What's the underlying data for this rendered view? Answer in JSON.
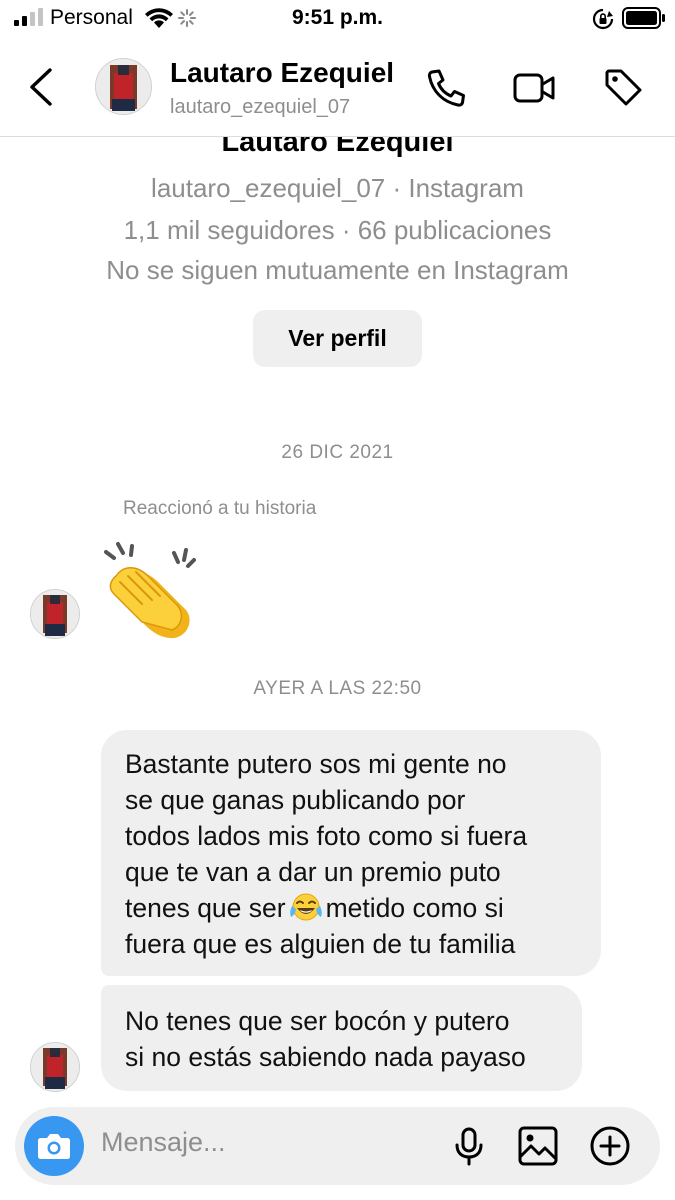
{
  "status_bar": {
    "carrier": "Personal",
    "time": "9:51 p.m."
  },
  "header": {
    "name": "Lautaro Ezequiel",
    "username": "lautaro_ezequiel_07"
  },
  "profile": {
    "name": "Lautaro Ezequiel",
    "username_platform": "lautaro_ezequiel_07 · Instagram",
    "stats": "1,1 mil seguidores · 66 publicaciones",
    "mutual": "No se siguen mutuamente en Instagram",
    "button": "Ver perfil"
  },
  "conversation": {
    "date1": "26 DIC 2021",
    "reaction_label": "Reaccionó a tu historia",
    "reaction_emoji": "clapping-hands",
    "date2": "AYER A LAS 22:50",
    "message1": {
      "line1": "Bastante putero sos mi gente no",
      "line2": "se que ganas publicando por",
      "line3": "todos lados mis foto como si fuera",
      "line4": "que te van a dar un premio puto",
      "line5_before": "tenes que ser",
      "line5_after": "metido como si",
      "line6": "fuera que es alguien de tu familia",
      "inline_emoji": "face-with-tears-of-joy"
    },
    "message2": {
      "line1": "No tenes que ser bocón y putero",
      "line2": "si no estás sabiendo nada payaso"
    }
  },
  "composer": {
    "placeholder": "Mensaje..."
  },
  "colors": {
    "accent": "#3897f0",
    "bubble": "#efefef",
    "secondary_text": "#8e8e8e"
  },
  "icons": [
    "signal-icon",
    "wifi-icon",
    "spinner-icon",
    "rotation-lock-icon",
    "battery-icon",
    "back-icon",
    "phone-icon",
    "video-icon",
    "tag-icon",
    "camera-icon",
    "microphone-icon",
    "gallery-icon",
    "plus-icon"
  ]
}
